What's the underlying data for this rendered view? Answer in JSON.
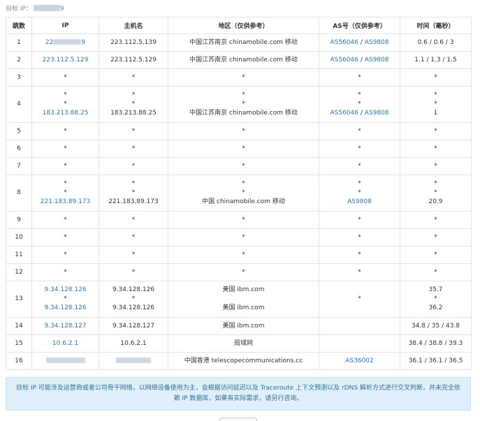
{
  "target": {
    "label": "目标 IP：",
    "tail": "9"
  },
  "table": {
    "headers": [
      "跳数",
      "IP",
      "主机名",
      "地区（仅供参考）",
      "AS号（仅供参考）",
      "时间（毫秒）"
    ],
    "rows": [
      {
        "hop": "1",
        "ip": [
          "22",
          "9"
        ],
        "host": [
          "223.112.5.139"
        ],
        "region": [
          "中国江苏南京 chinamobile.com 移动"
        ],
        "as": [
          [
            "AS56046",
            "AS9808"
          ]
        ],
        "time": [
          "0.6 / 0.6 / 3"
        ]
      },
      {
        "hop": "2",
        "ip": [
          "223.112.5.129"
        ],
        "host": [
          "223.112.5.129"
        ],
        "region": [
          "中国江苏南京 chinamobile.com 移动"
        ],
        "as": [
          [
            "AS56046",
            "AS9808"
          ]
        ],
        "time": [
          "1.1 / 1.3 / 1.5"
        ]
      },
      {
        "hop": "3",
        "ip": [
          "*"
        ],
        "host": [
          "*"
        ],
        "region": [
          "*"
        ],
        "as": [
          [
            "*"
          ]
        ],
        "time": [
          "*"
        ]
      },
      {
        "hop": "4",
        "ip": [
          "*",
          "*",
          "183.213.88.25"
        ],
        "host": [
          "*",
          "*",
          "183.213.88.25"
        ],
        "region": [
          "*",
          "*",
          "中国江苏南京 chinamobile.com 移动"
        ],
        "as": [
          [
            "*"
          ],
          [
            "*"
          ],
          [
            "AS56046",
            "AS9808"
          ]
        ],
        "time": [
          "*",
          "*",
          "1"
        ]
      },
      {
        "hop": "5",
        "ip": [
          "*"
        ],
        "host": [
          "*"
        ],
        "region": [
          "*"
        ],
        "as": [
          [
            "*"
          ]
        ],
        "time": [
          "*"
        ]
      },
      {
        "hop": "6",
        "ip": [
          "*"
        ],
        "host": [
          "*"
        ],
        "region": [
          "*"
        ],
        "as": [
          [
            "*"
          ]
        ],
        "time": [
          "*"
        ]
      },
      {
        "hop": "7",
        "ip": [
          "*"
        ],
        "host": [
          "*"
        ],
        "region": [
          "*"
        ],
        "as": [
          [
            "*"
          ]
        ],
        "time": [
          "*"
        ]
      },
      {
        "hop": "8",
        "ip": [
          "*",
          "*",
          "221.183.89.173"
        ],
        "host": [
          "*",
          "*",
          "221.183.89.173"
        ],
        "region": [
          "*",
          "*",
          "中国 chinamobile.com 移动"
        ],
        "as": [
          [
            "*"
          ],
          [
            "*"
          ],
          [
            "AS9808"
          ]
        ],
        "time": [
          "*",
          "*",
          "20.9"
        ]
      },
      {
        "hop": "9",
        "ip": [
          "*"
        ],
        "host": [
          "*"
        ],
        "region": [
          "*"
        ],
        "as": [
          [
            "*"
          ]
        ],
        "time": [
          "*"
        ]
      },
      {
        "hop": "10",
        "ip": [
          "*"
        ],
        "host": [
          "*"
        ],
        "region": [
          "*"
        ],
        "as": [
          [
            "*"
          ]
        ],
        "time": [
          "*"
        ]
      },
      {
        "hop": "11",
        "ip": [
          "*"
        ],
        "host": [
          "*"
        ],
        "region": [
          "*"
        ],
        "as": [
          [
            "*"
          ]
        ],
        "time": [
          "*"
        ]
      },
      {
        "hop": "12",
        "ip": [
          "*"
        ],
        "host": [
          "*"
        ],
        "region": [
          "*"
        ],
        "as": [
          [
            "*"
          ]
        ],
        "time": [
          "*"
        ]
      },
      {
        "hop": "13",
        "ip": [
          "9.34.128.126",
          "*",
          "9.34.128.126"
        ],
        "host": [
          "9.34.128.126",
          "*",
          "9.34.128.126"
        ],
        "region": [
          "美国 ibm.com",
          "",
          "美国 ibm.com"
        ],
        "as": [
          [
            "*"
          ]
        ],
        "time": [
          "35.7",
          "*",
          "36.2"
        ]
      },
      {
        "hop": "14",
        "ip": [
          "9.34.128.127"
        ],
        "host": [
          "9.34.128.127"
        ],
        "region": [
          "美国 ibm.com"
        ],
        "as": [
          [
            ""
          ]
        ],
        "time": [
          "34.8 / 35 / 43.8"
        ]
      },
      {
        "hop": "15",
        "ip": [
          "10.6.2.1"
        ],
        "host": [
          "10.6.2.1"
        ],
        "region": [
          "局域网"
        ],
        "as": [
          [
            ""
          ]
        ],
        "time": [
          "38.4 / 38.8 / 39.3"
        ]
      },
      {
        "hop": "16",
        "ip": [
          ""
        ],
        "host": [
          ""
        ],
        "region": [
          "中国香港 telescopecommunications.cc"
        ],
        "as": [
          [
            "AS36002"
          ]
        ],
        "time": [
          "36.1 / 36.1 / 36.5"
        ]
      }
    ]
  },
  "notice": {
    "text": "目标 IP 可能涉及运营商或者公司骨干网络，以网络设备使用为主，会根据访问延迟以及 Traceroute 上下文预测以及 rDNS 解析方式进行交叉判断，并未完全依赖 IP 数据库，如果有实际需求，请另行咨询。"
  }
}
